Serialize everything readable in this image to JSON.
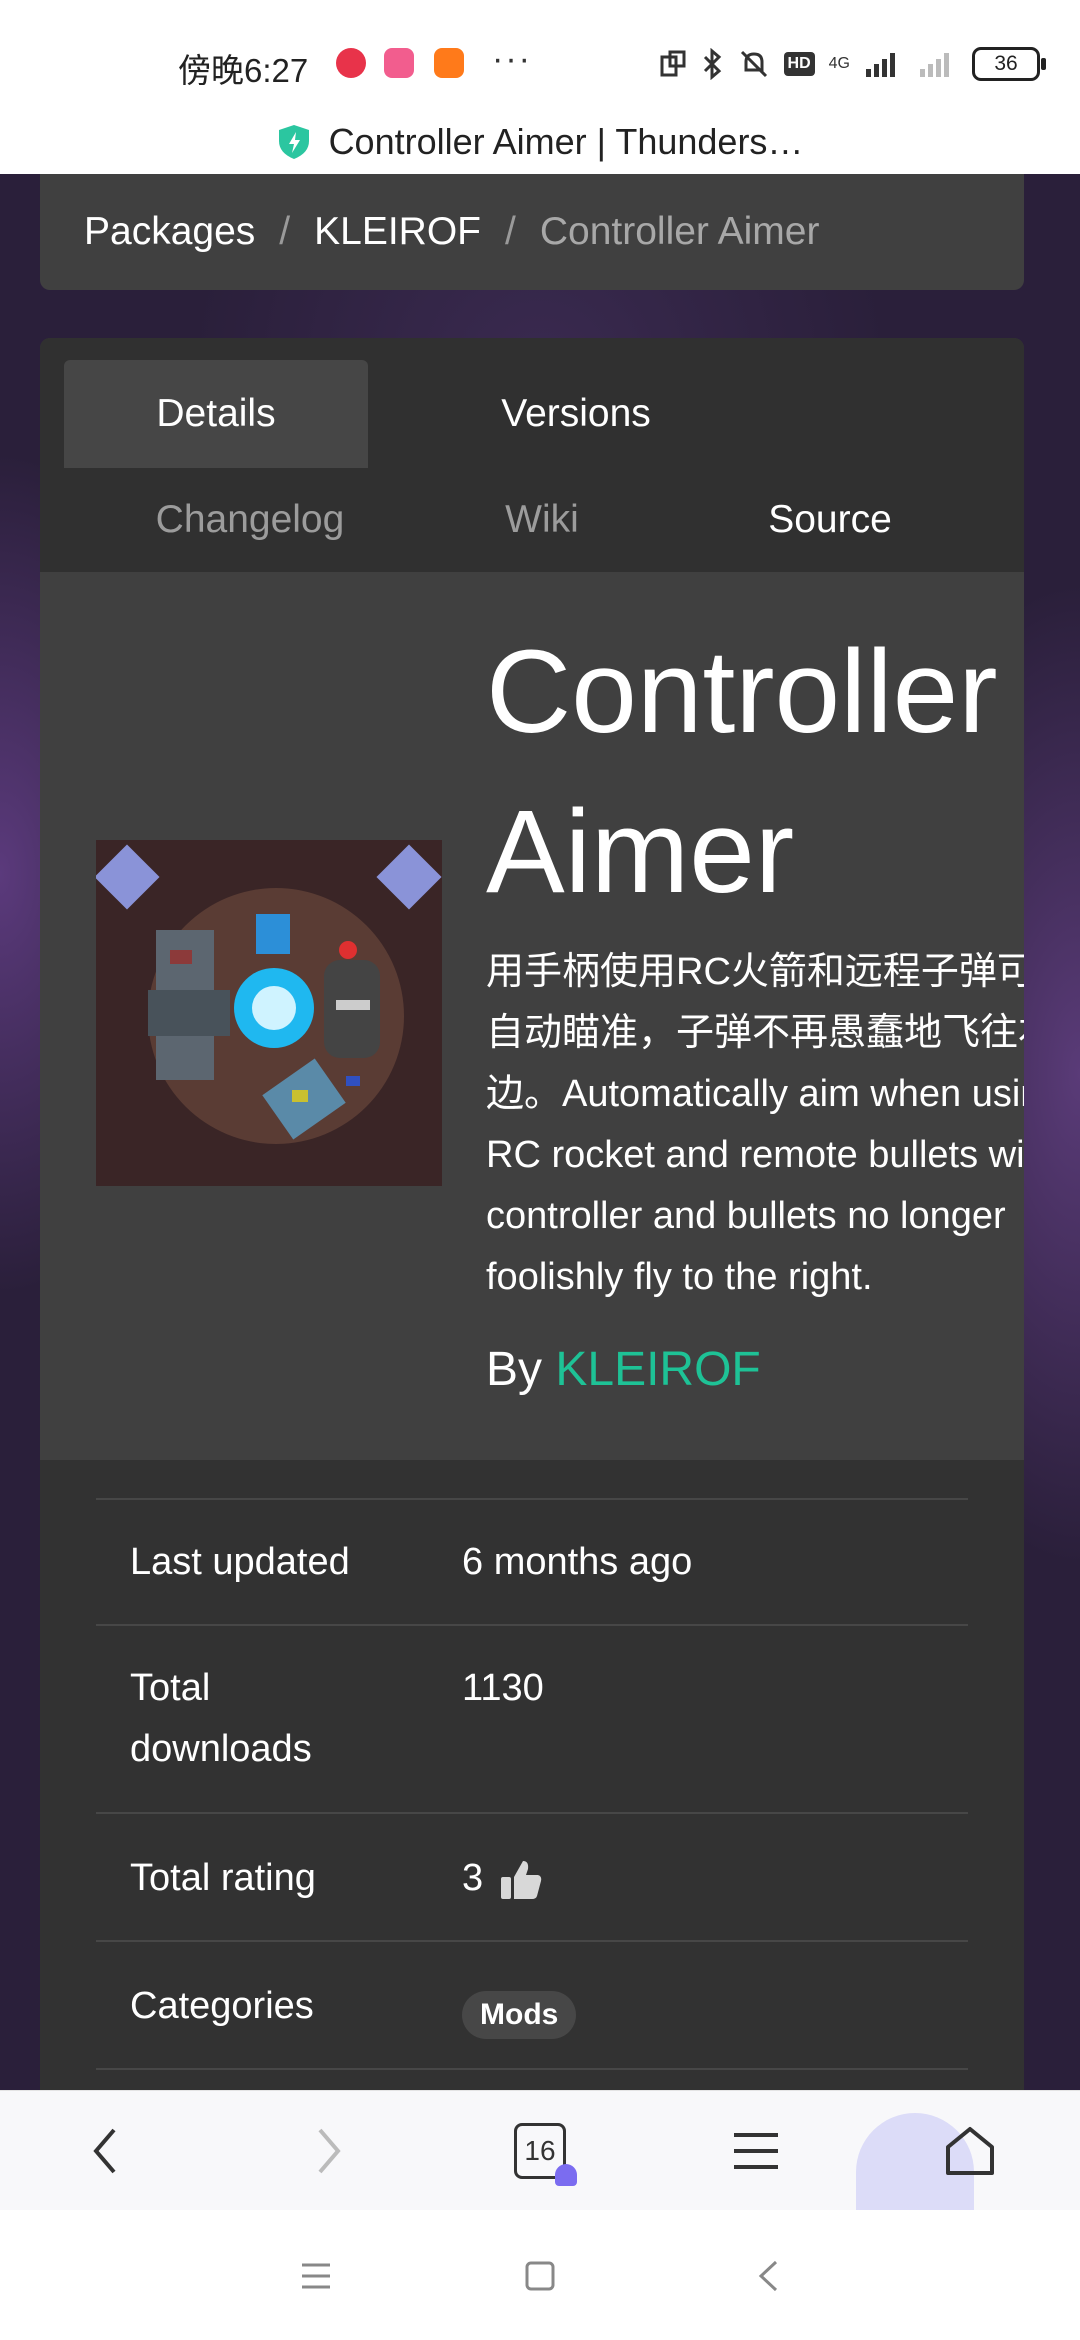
{
  "status_bar": {
    "time": "傍晚6:27",
    "more": "···",
    "network": "4G",
    "battery": "36"
  },
  "browser": {
    "page_title": "Controller Aimer | Thunders…",
    "tab_count": "16"
  },
  "breadcrumb": {
    "items": [
      "Packages",
      "KLEIROF",
      "Controller Aimer"
    ]
  },
  "tabs": {
    "details": "Details",
    "versions": "Versions",
    "changelog": "Changelog",
    "wiki": "Wiki",
    "source": "Source"
  },
  "package": {
    "title_line1": "Controller",
    "title_line2": "Aimer",
    "description": "用手柄使用RC火箭和远程子弹可以自动瞄准，子弹不再愚蠢地飞往右边。Automatically aim when using RC rocket and remote bullets with controller and bullets no longer foolishly fly to the right.",
    "by_label": "By",
    "author": "KLEIROF"
  },
  "meta": {
    "last_updated_label": "Last updated",
    "last_updated_value": "6 months ago",
    "total_downloads_label": "Total downloads",
    "total_downloads_value": "1130",
    "total_rating_label": "Total rating",
    "total_rating_value": "3",
    "categories_label": "Categories",
    "category_badge": "Mods"
  },
  "colors": {
    "accent_link": "#1ec296",
    "card_bg": "#404040",
    "tabcount_badge": "#7b6cf0"
  }
}
